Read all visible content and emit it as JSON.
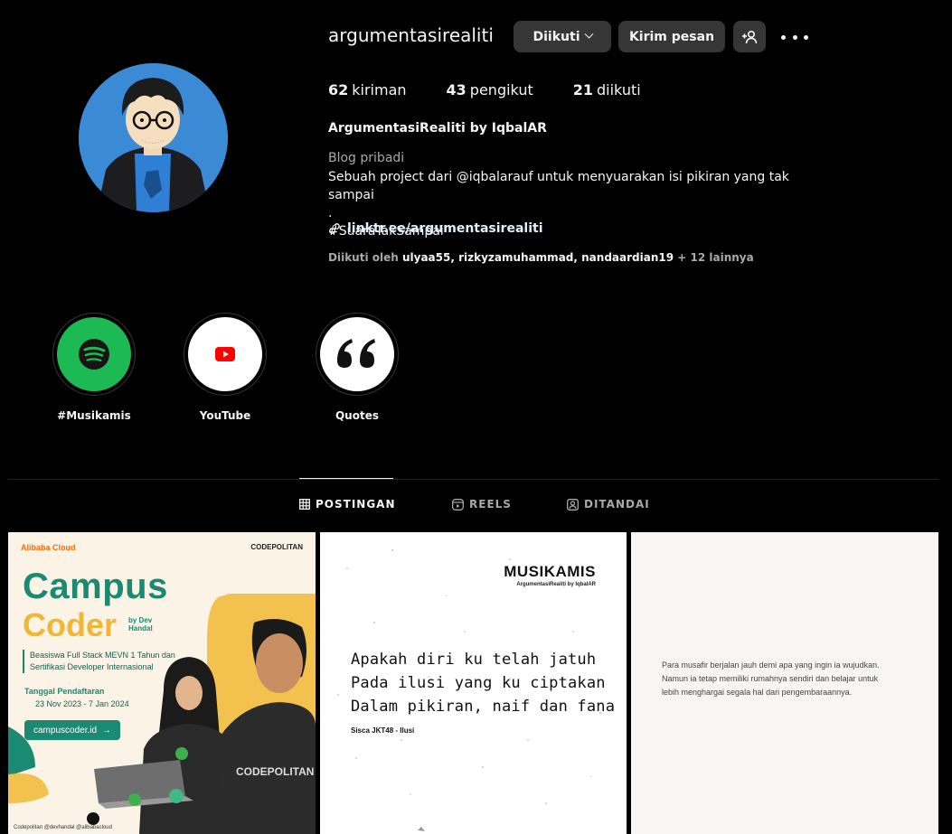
{
  "profile": {
    "username": "argumentasirealiti",
    "follow_button": "Diikuti",
    "message_button": "Kirim pesan",
    "stats": {
      "posts_count": "62",
      "posts_label": "kiriman",
      "followers_count": "43",
      "followers_label": "pengikut",
      "following_count": "21",
      "following_label": "diikuti"
    },
    "full_name": "ArgumentasiRealiti by IqbalAR",
    "category": "Blog pribadi",
    "bio": "Sebuah project dari @iqbalarauf untuk menyuarakan isi pikiran yang tak sampai\n.\n#SuaraTakSampai",
    "link": "linktr.ee/argumentasirealiti",
    "followed_by": {
      "prefix": "Diikuti oleh",
      "names": [
        "ulyaa55",
        "rizkyzamuhammad",
        "nandaardian19"
      ],
      "suffix": "+ 12 lainnya"
    }
  },
  "highlights": [
    {
      "label": "#Musikamis",
      "icon": "spotify-icon"
    },
    {
      "label": "YouTube",
      "icon": "youtube-icon"
    },
    {
      "label": "Quotes",
      "icon": "quote-icon"
    }
  ],
  "tabs": [
    {
      "label": "POSTINGAN",
      "icon": "grid-icon",
      "active": true
    },
    {
      "label": "REELS",
      "icon": "reels-icon",
      "active": false
    },
    {
      "label": "DITANDAI",
      "icon": "tagged-icon",
      "active": false
    }
  ],
  "posts": {
    "post1": {
      "brand_left": "Alibaba Cloud",
      "brand_right": "CODEPOLITAN",
      "title_line1": "Campus",
      "title_line2": "Coder",
      "by": "by Dev Handal",
      "description": "Beasiswa Full Stack MEVN 1 Tahun dan Sertifikasi Developer Internasional",
      "date_label": "Tanggal Pendaftaran",
      "date_range": "23 Nov 2023 - 7 Jan 2024",
      "url": "campuscoder.id",
      "footer": "Codepolitan  @devhandal  @alibabacloud",
      "shirt_text": "CODEPOLITAN"
    },
    "post2": {
      "title": "MUSIKAMIS",
      "subtitle": "ArgumentasiRealiti by IqbalAR",
      "lyrics": "Apakah diri ku telah jatuh\nPada ilusi yang ku ciptakan\nDalam pikiran, naif dan fana",
      "credit": "Sisca JKT48 - Ilusi"
    },
    "post3": {
      "text": "Para musafir berjalan jauh demi apa yang ingin ia wujudkan. Namun ia tetap memiliki rumahnya sendiri dan belajar untuk lebih menghargai segala hal dari pengembaraannya."
    }
  },
  "colors": {
    "background": "#000000",
    "button_bg": "#363636",
    "spotify_green": "#1DB954",
    "youtube_red": "#FF0000",
    "post1_teal": "#1a8a73",
    "post1_yellow": "#f2b632"
  }
}
